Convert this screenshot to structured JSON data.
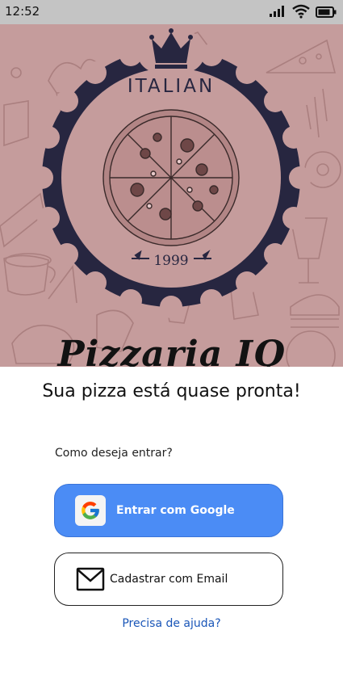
{
  "status": {
    "time": "12:52"
  },
  "hero": {
    "badge_top_text": "ITALIAN",
    "badge_year": "1999",
    "title": "Pizzaria IQ"
  },
  "headline": "Sua pizza está quase pronta!",
  "login": {
    "prompt": "Como deseja entrar?",
    "google_label": "Entrar com Google",
    "email_label": "Cadastrar com Email",
    "help_link": "Precisa de ajuda?"
  },
  "colors": {
    "hero_bg": "#c59c9c",
    "badge_navy": "#272640",
    "google_button": "#4b8cf5",
    "link": "#1a56b8"
  },
  "icons": [
    "signal-icon",
    "wifi-icon",
    "battery-icon",
    "crown-icon",
    "pizza-icon",
    "google-icon",
    "mail-icon"
  ]
}
